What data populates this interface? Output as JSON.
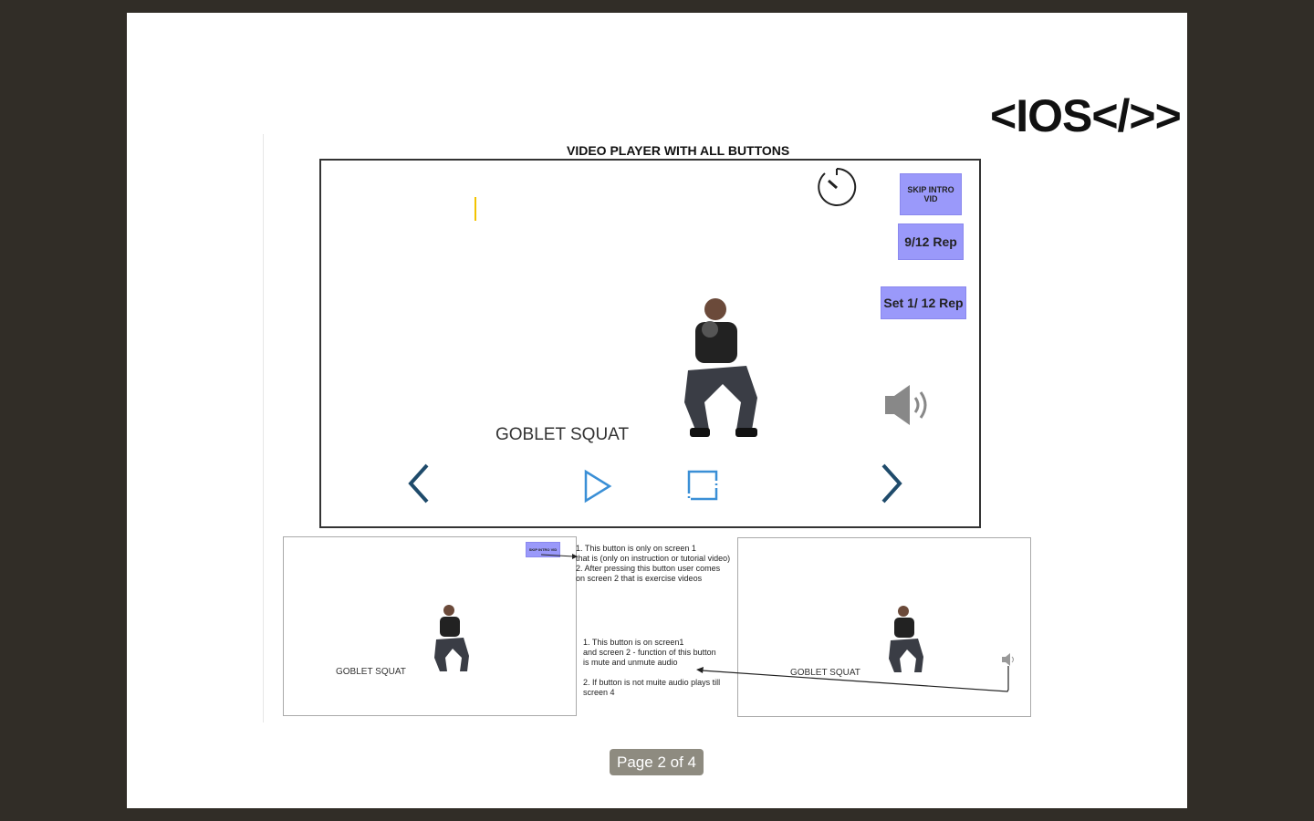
{
  "logo": "<IOS</>>",
  "title": "VIDEO PLAYER WITH ALL BUTTONS",
  "player": {
    "skip": "SKIP INTRO VID",
    "rep": "9/12 Rep",
    "set": "Set 1/ 12 Rep",
    "exercise": "GOBLET SQUAT"
  },
  "thumb1": {
    "skip": "SKIP INTRO VID",
    "exercise": "GOBLET SQUAT"
  },
  "thumb2": {
    "exercise": "GOBLET SQUAT"
  },
  "notes": {
    "skip": [
      "1. This button is only on screen 1",
      "that is (only on instruction or tutorial video)",
      "2. After pressing this button user comes",
      "on screen 2 that is exercise videos"
    ],
    "audio": [
      "1. This button is on screen1",
      "and screen 2 - function of this button",
      "is mute and unmute audio",
      "",
      "2. If button is not muite audio plays till",
      "screen 4"
    ]
  },
  "pager": "Page 2 of 4"
}
